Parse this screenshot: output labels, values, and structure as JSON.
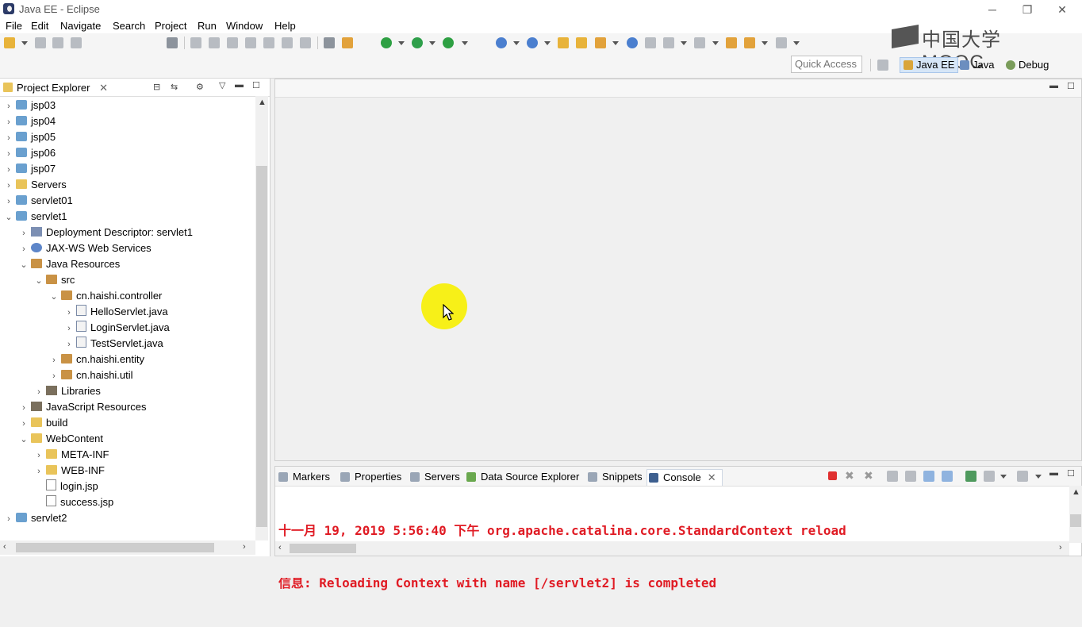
{
  "window": {
    "title": "Java EE - Eclipse",
    "minimize": "─",
    "maximize": "❐",
    "close": "✕"
  },
  "menu": [
    "File",
    "Edit",
    "Navigate",
    "Search",
    "Project",
    "Run",
    "Window",
    "Help"
  ],
  "toolbar": {
    "quick_access_placeholder": "Quick Access"
  },
  "perspectives": [
    {
      "label": "Java EE",
      "active": true
    },
    {
      "label": "Java",
      "active": false
    },
    {
      "label": "Debug",
      "active": false
    }
  ],
  "logo": {
    "text": "中国大学MOOC"
  },
  "project_explorer": {
    "title": "Project Explorer",
    "tree": [
      {
        "label": "jsp03",
        "depth": 0,
        "chev": "›",
        "icon": "project"
      },
      {
        "label": "jsp04",
        "depth": 0,
        "chev": "›",
        "icon": "project"
      },
      {
        "label": "jsp05",
        "depth": 0,
        "chev": "›",
        "icon": "project"
      },
      {
        "label": "jsp06",
        "depth": 0,
        "chev": "›",
        "icon": "project"
      },
      {
        "label": "jsp07",
        "depth": 0,
        "chev": "›",
        "icon": "project"
      },
      {
        "label": "Servers",
        "depth": 0,
        "chev": "›",
        "icon": "folder"
      },
      {
        "label": "servlet01",
        "depth": 0,
        "chev": "›",
        "icon": "project"
      },
      {
        "label": "servlet1",
        "depth": 0,
        "chev": "⌄",
        "icon": "project"
      },
      {
        "label": "Deployment Descriptor: servlet1",
        "depth": 1,
        "chev": "›",
        "icon": "srv"
      },
      {
        "label": "JAX-WS Web Services",
        "depth": 1,
        "chev": "›",
        "icon": "web"
      },
      {
        "label": "Java Resources",
        "depth": 1,
        "chev": "⌄",
        "icon": "pkg"
      },
      {
        "label": "src",
        "depth": 2,
        "chev": "⌄",
        "icon": "pkg"
      },
      {
        "label": "cn.haishi.controller",
        "depth": 3,
        "chev": "⌄",
        "icon": "pkg"
      },
      {
        "label": "HelloServlet.java",
        "depth": 4,
        "chev": "›",
        "icon": "java"
      },
      {
        "label": "LoginServlet.java",
        "depth": 4,
        "chev": "›",
        "icon": "java"
      },
      {
        "label": "TestServlet.java",
        "depth": 4,
        "chev": "›",
        "icon": "java"
      },
      {
        "label": "cn.haishi.entity",
        "depth": 3,
        "chev": "›",
        "icon": "pkg"
      },
      {
        "label": "cn.haishi.util",
        "depth": 3,
        "chev": "›",
        "icon": "pkg"
      },
      {
        "label": "Libraries",
        "depth": 2,
        "chev": "›",
        "icon": "lib"
      },
      {
        "label": "JavaScript Resources",
        "depth": 1,
        "chev": "›",
        "icon": "lib"
      },
      {
        "label": "build",
        "depth": 1,
        "chev": "›",
        "icon": "folder"
      },
      {
        "label": "WebContent",
        "depth": 1,
        "chev": "⌄",
        "icon": "folder"
      },
      {
        "label": "META-INF",
        "depth": 2,
        "chev": "›",
        "icon": "folder"
      },
      {
        "label": "WEB-INF",
        "depth": 2,
        "chev": "›",
        "icon": "folder"
      },
      {
        "label": "login.jsp",
        "depth": 2,
        "chev": "",
        "icon": "jsp"
      },
      {
        "label": "success.jsp",
        "depth": 2,
        "chev": "",
        "icon": "jsp"
      },
      {
        "label": "servlet2",
        "depth": 0,
        "chev": "›",
        "icon": "project"
      }
    ]
  },
  "bottom_tabs": [
    {
      "label": "Markers",
      "active": false
    },
    {
      "label": "Properties",
      "active": false
    },
    {
      "label": "Servers",
      "active": false
    },
    {
      "label": "Data Source Explorer",
      "active": false
    },
    {
      "label": "Snippets",
      "active": false
    },
    {
      "label": "Console",
      "active": true
    }
  ],
  "console": {
    "lines": [
      "十一月 19, 2019 5:56:40 下午 org.apache.catalina.core.StandardContext reload",
      "信息: Reloading Context with name [/servlet2] is completed"
    ],
    "color": "#e01b24"
  }
}
